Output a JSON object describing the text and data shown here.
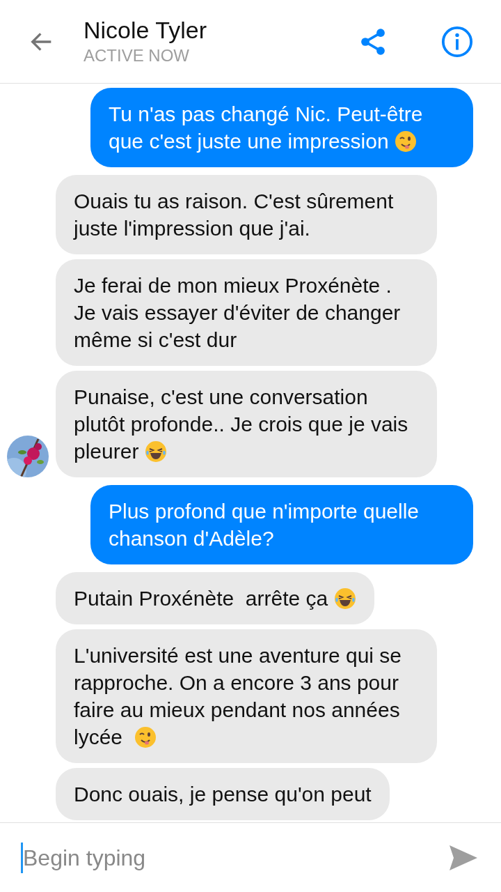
{
  "header": {
    "name": "Nicole Tyler",
    "status": "ACTIVE NOW"
  },
  "messages": [
    {
      "kind": "sent",
      "content": [
        {
          "kind": "text",
          "text": "Tu n'as pas changé Nic. Peut-être que c'est juste une impression "
        },
        {
          "kind": "wink_emoji"
        }
      ],
      "avatar": false
    },
    {
      "kind": "received",
      "content": [
        {
          "kind": "text",
          "text": "Ouais tu as raison. C'est sûrement juste l'impression que j'ai."
        }
      ],
      "avatar": false
    },
    {
      "kind": "received",
      "content": [
        {
          "kind": "text",
          "text": "Je ferai de mon mieux Proxénète . Je vais essayer d'éviter de changer même si c'est dur"
        }
      ],
      "avatar": false
    },
    {
      "kind": "received",
      "content": [
        {
          "kind": "text",
          "text": "Punaise, c'est une conversation plutôt profonde.. Je crois que je vais pleurer "
        },
        {
          "kind": "laugh_emoji"
        }
      ],
      "avatar": true
    },
    {
      "kind": "sent",
      "content": [
        {
          "kind": "text",
          "text": "Plus profond que n'importe quelle chanson d'Adèle?"
        }
      ],
      "avatar": false
    },
    {
      "kind": "received",
      "content": [
        {
          "kind": "text",
          "text": "Putain Proxénète  arrête ça "
        },
        {
          "kind": "laugh_emoji"
        }
      ],
      "avatar": false
    },
    {
      "kind": "received",
      "content": [
        {
          "kind": "text",
          "text": "L'université est une aventure qui se rapproche. On a encore 3 ans pour faire au mieux pendant nos années lycée  "
        },
        {
          "kind": "wink_emoji"
        }
      ],
      "avatar": false
    },
    {
      "kind": "received",
      "content": [
        {
          "kind": "text",
          "text": "Donc ouais, je pense qu'on peut"
        }
      ],
      "avatar": false
    }
  ],
  "composer": {
    "placeholder": "Begin typing"
  }
}
